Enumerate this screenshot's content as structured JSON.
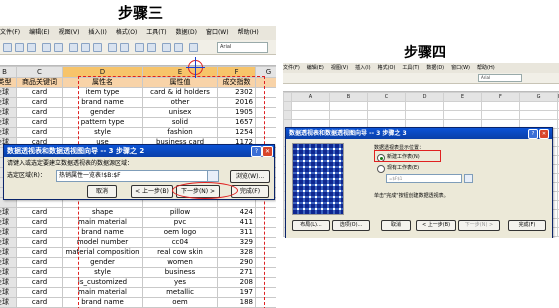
{
  "headings": {
    "step3": "步骤三",
    "step4": "步骤四"
  },
  "left": {
    "menu": [
      "文件(F)",
      "编辑(E)",
      "视图(V)",
      "插入(I)",
      "格式(O)",
      "工具(T)",
      "数据(D)",
      "窗口(W)",
      "帮助(H)"
    ],
    "toolbar_font": "Arial",
    "col_headers": [
      "B",
      "C",
      "D",
      "E",
      "F",
      "G"
    ],
    "header_row": [
      "类型",
      "商品关键词",
      "属性名",
      "属性值",
      "成交指数"
    ],
    "rows_top": [
      [
        "全球",
        "card",
        "item type",
        "card & id holders",
        "2302"
      ],
      [
        "全球",
        "card",
        "brand name",
        "other",
        "2016"
      ],
      [
        "全球",
        "card",
        "gender",
        "unisex",
        "1905"
      ],
      [
        "全球",
        "card",
        "pattern type",
        "solid",
        "1657"
      ],
      [
        "全球",
        "card",
        "style",
        "fashion",
        "1254"
      ],
      [
        "全球",
        "card",
        "use",
        "business card",
        "1172"
      ]
    ],
    "rows_bottom": [
      [
        "全球",
        "card",
        "shape",
        "pillow",
        "424"
      ],
      [
        "全球",
        "card",
        "main material",
        "pvc",
        "411"
      ],
      [
        "全球",
        "card",
        "brand name",
        "oem logo",
        "311"
      ],
      [
        "全球",
        "card",
        "model number",
        "cc04",
        "329"
      ],
      [
        "全球",
        "card",
        "material composition",
        "real cow skin",
        "328"
      ],
      [
        "全球",
        "card",
        "gender",
        "women",
        "290"
      ],
      [
        "全球",
        "card",
        "style",
        "business",
        "271"
      ],
      [
        "全球",
        "card",
        "is_customized",
        "yes",
        "208"
      ],
      [
        "全球",
        "card",
        "main material",
        "metallic",
        "197"
      ],
      [
        "全球",
        "card",
        "brand name",
        "oem",
        "188"
      ],
      [
        "全球",
        "card",
        "material composition",
        "pu",
        "187"
      ]
    ],
    "dialog": {
      "title": "数据透视表和数据透视图向导 -- 3 步骤之 2",
      "prompt": "请键入或选定要建立数据透视表的数据源区域：",
      "range_label": "选定区域(R)：",
      "range_value": "热销属性一览表!$B:$F",
      "browse": "浏览(W)...",
      "cancel": "取消",
      "back": "< 上一步(B)",
      "next": "下一步(N) >",
      "finish": "完成(F)"
    }
  },
  "right": {
    "menu": [
      "文件(F)",
      "编辑(E)",
      "视图(V)",
      "插入(I)",
      "格式(O)",
      "工具(T)",
      "数据(D)",
      "窗口(W)",
      "帮助(H)"
    ],
    "toolbar_font": "Arial",
    "col_headers": [
      "A",
      "B",
      "C",
      "D",
      "E",
      "F",
      "G",
      "H"
    ],
    "dialog": {
      "title": "数据透视表和数据透视图向导 -- 3 步骤之 3",
      "position_label": "数据透视表显示位置：",
      "option_new": "新建工作表(N)",
      "option_existing": "现有工作表(E)",
      "ref_value": "=$F$1",
      "hint": "单击\"完成\"按钮创建数据透视表。",
      "layout": "布局(L)...",
      "options": "选项(O)...",
      "cancel": "取消",
      "back": "< 上一步(B)",
      "next": "下一步(N) >",
      "finish": "完成(F)"
    }
  },
  "colors": {
    "highlight": "#e02020",
    "title_bar": "#0a3fa8",
    "header_fill": "#f8d3a8"
  }
}
